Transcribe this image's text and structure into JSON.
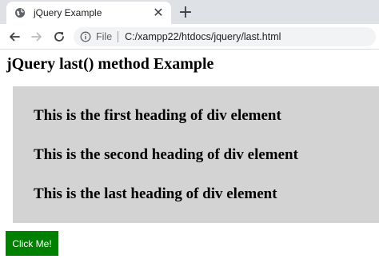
{
  "browser": {
    "tab": {
      "title": "jQuery Example",
      "favicon": "globe-icon",
      "close_glyph": "✕"
    },
    "new_tab_glyph": "+",
    "address_bar": {
      "scheme_label": "File",
      "url": "C:/xampp22/htdocs/jquery/last.html"
    }
  },
  "page": {
    "title": "jQuery last() method Example",
    "div": {
      "background": "#d3d3d3",
      "headings": [
        "This is the first heading of div element",
        "This is the second heading of div element",
        "This is the last heading of div element"
      ]
    },
    "button": {
      "label": "Click Me!",
      "background": "#008000",
      "color": "#ffffff"
    }
  }
}
